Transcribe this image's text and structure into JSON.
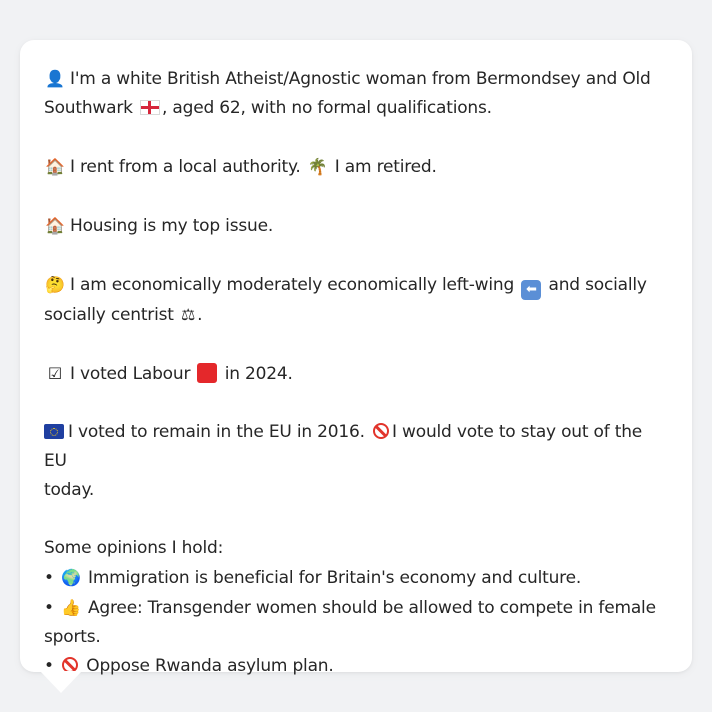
{
  "profile": {
    "p1": {
      "icon": "person-icon",
      "text_a": "I'm a white British Atheist/Agnostic woman from Bermondsey and Old",
      "text_b": "Southwark",
      "flag": "england-flag-icon",
      "text_c": ", aged 62, with no formal qualifications."
    },
    "p2": {
      "icon": "house-icon",
      "text_a": "I rent from a local authority.",
      "icon2": "palm-tree-icon",
      "text_b": "I am retired."
    },
    "p3": {
      "icon": "house-icon",
      "text": "Housing is my top issue."
    },
    "p4": {
      "icon": "thinking-face-icon",
      "text_a": "I am economically moderately economically left-wing",
      "icon2": "left-arrow-icon",
      "text_b": "and socially",
      "text_c": "socially centrist",
      "icon3": "scales-icon",
      "text_d": "."
    },
    "p5": {
      "icon": "ballot-box-icon",
      "text_a": "I voted Labour",
      "party_color": "#e4282b",
      "text_b": "in 2024."
    },
    "p6": {
      "icon": "eu-flag-icon",
      "text_a": "I voted to remain in the EU in 2016.",
      "icon2": "prohibited-icon",
      "text_b": "I would vote to stay out of the EU",
      "text_c": "today."
    },
    "opinions": {
      "heading": "Some opinions I hold:",
      "bullet": "•",
      "items": [
        {
          "icon": "globe-icon",
          "text": "Immigration is beneficial for Britain's economy and culture."
        },
        {
          "icon": "thumbs-up-icon",
          "text_a": "Agree: Transgender women should be allowed to compete in female",
          "text_b": "sports."
        },
        {
          "icon": "prohibited-icon",
          "text": "Oppose Rwanda asylum plan."
        }
      ]
    }
  }
}
